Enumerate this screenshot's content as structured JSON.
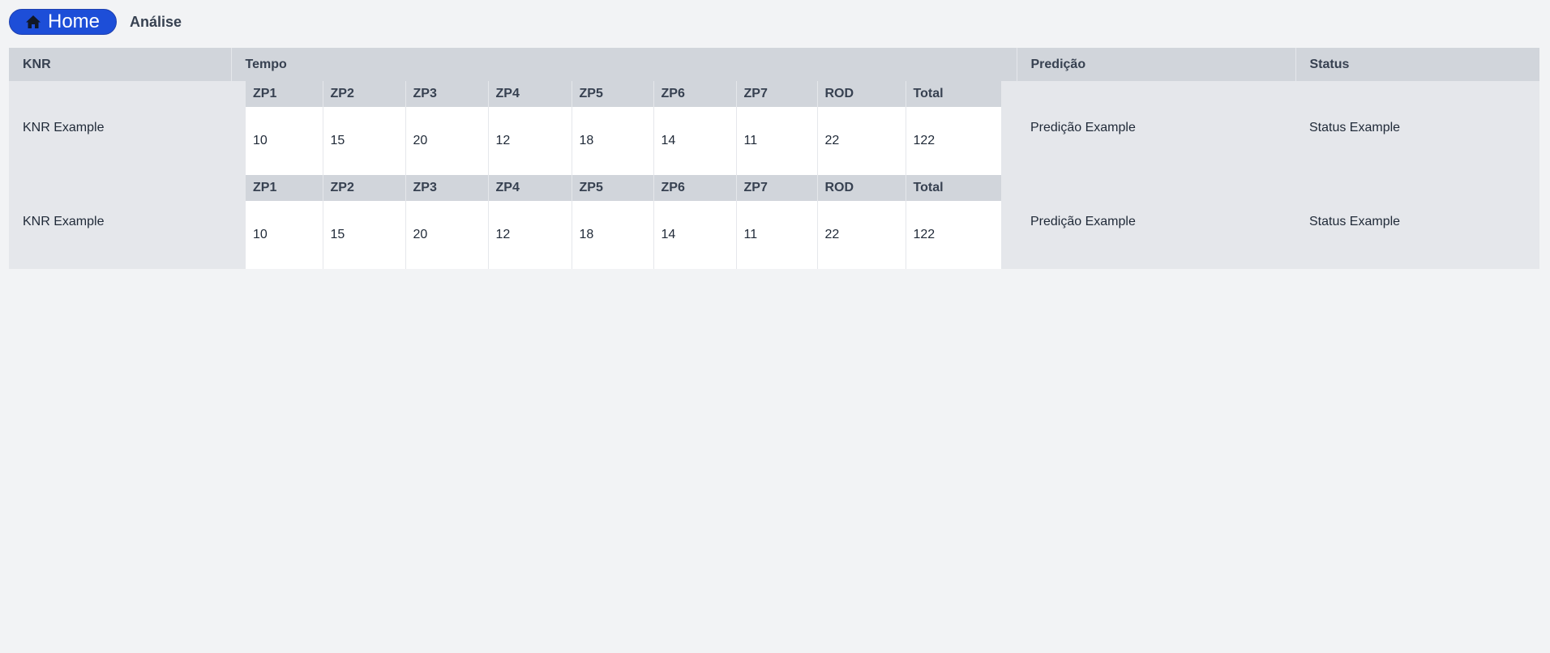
{
  "nav": {
    "home_label": "Home",
    "home_icon": "home-icon",
    "breadcrumb": "Análise",
    "accent": "#1d4ed8"
  },
  "table": {
    "headers": [
      "KNR",
      "Tempo",
      "Predição",
      "Status"
    ],
    "rows": [
      {
        "knr": "KNR Example",
        "tempo": {
          "headers": [
            "ZP1",
            "ZP2",
            "ZP3",
            "ZP4",
            "ZP5",
            "ZP6",
            "ZP7",
            "ROD",
            "Total"
          ],
          "values": [
            "10",
            "15",
            "20",
            "12",
            "18",
            "14",
            "11",
            "22",
            "122"
          ]
        },
        "predicao": "Predição Example",
        "status": "Status Example"
      },
      {
        "knr": "KNR Example",
        "tempo": {
          "headers": [
            "ZP1",
            "ZP2",
            "ZP3",
            "ZP4",
            "ZP5",
            "ZP6",
            "ZP7",
            "ROD",
            "Total"
          ],
          "values": [
            "10",
            "15",
            "20",
            "12",
            "18",
            "14",
            "11",
            "22",
            "122"
          ]
        },
        "predicao": "Predição Example",
        "status": "Status Example"
      }
    ]
  }
}
